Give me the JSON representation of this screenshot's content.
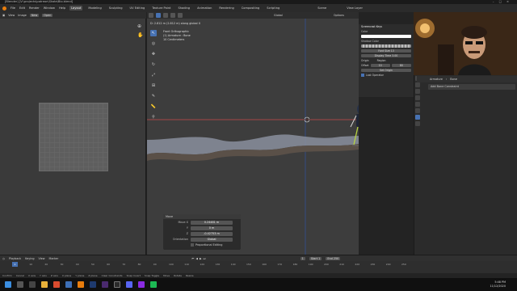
{
  "title": "[Blender] [V:\\projects\\patreon\\Skate\\Bio.blend]",
  "menu": {
    "items": [
      "File",
      "Edit",
      "Render",
      "Window",
      "Help"
    ],
    "workspaces": [
      "Layout",
      "Modeling",
      "Sculpting",
      "UV Editing",
      "Texture Paint",
      "Shading",
      "Animation",
      "Rendering",
      "Compositing",
      "Scripting"
    ],
    "active_workspace": "Layout",
    "scene_label": "Scene",
    "view_layer_label": "View Layer"
  },
  "image_editor": {
    "view": "View",
    "image": "Image",
    "new_btn": "New",
    "open_btn": "Open"
  },
  "viewport": {
    "header_mode": "Global",
    "header_options": "Options",
    "move_info": "D: 2.812 m (2.812 m) along global X",
    "view_name": "Front Orthographic",
    "object_name": "(1) Armature : Bone",
    "scale": "10 Centimeters"
  },
  "move_panel": {
    "title": "Move",
    "move_x_label": "Move X",
    "move_x": "0.24481 m",
    "y_label": "Y",
    "y": "0 m",
    "z_label": "Z",
    "z": "-0.42753 m",
    "orientation_label": "Orientation",
    "orientation": "Global",
    "proportional": "Proportional Editing"
  },
  "screencast": {
    "title": "Screencast Keys",
    "color_label": "Color",
    "shadow_label": "Shadow Color",
    "font_size_label": "Font Size",
    "font_size": "13",
    "display_time_label": "Display Time",
    "display_time": "3.00",
    "origin_label": "Origin",
    "region_label": "Region",
    "offset_label": "Offset",
    "offset_x": "10",
    "offset_y": "80",
    "set_origin": "Set Origin",
    "last_operator": "Last Operator"
  },
  "properties": {
    "armature": "Armature",
    "bone": "Bone",
    "add_constraint": "Add Bone Constraint"
  },
  "timeline": {
    "playback": "Playback",
    "keying": "Keying",
    "view": "View",
    "marker": "Marker",
    "current_frame": "1",
    "start_label": "Start",
    "start": "1",
    "end_label": "End",
    "end": "250",
    "ticks": [
      "0",
      "10",
      "20",
      "30",
      "40",
      "50",
      "60",
      "70",
      "80",
      "90",
      "100",
      "110",
      "120",
      "130",
      "140",
      "150",
      "160",
      "170",
      "180",
      "190",
      "200",
      "210",
      "220",
      "230",
      "240",
      "250"
    ]
  },
  "statusbar": {
    "items": [
      "Confirm",
      "Cancel",
      "X axis",
      "Y axis",
      "Z axis",
      "X plane",
      "Y plane",
      "Z plane",
      "Clear Constraints",
      "Snap Invert",
      "Snap Toggle",
      "Move",
      "Rotate",
      "Resize"
    ]
  },
  "clock": {
    "time": "5:48 PM",
    "date": "11/12/2020"
  },
  "colors": {
    "accent": "#4772b3",
    "ground": "#8a8f9e",
    "red_axis": "#c94b4b"
  }
}
